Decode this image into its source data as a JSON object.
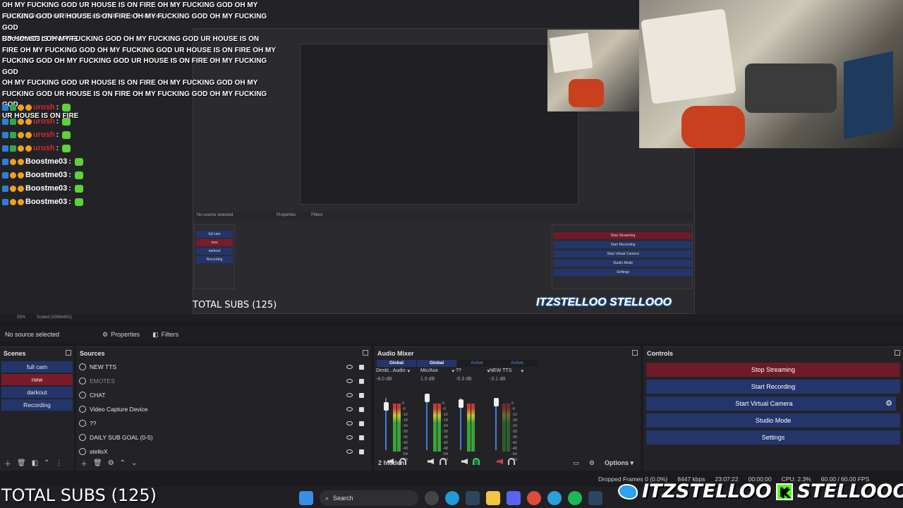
{
  "chat": {
    "top_lines": [
      "OH MY FUCKING GOD UR HOUSE IS ON FIRE OH MY FUCKING GOD OH MY",
      "FUCKING GOD UR HOUSE IS ON FIRE OH MY FUCKING GOD OH MY FUCKING GOD",
      "UR HOUSE IS ON FIRE"
    ],
    "second_lines": [
      "Boostme03 : OH MY FUCKING GOD OH MY FUCKING GOD UR HOUSE IS ON",
      "FIRE OH MY FUCKING GOD OH MY FUCKING GOD UR HOUSE IS ON FIRE OH MY",
      "FUCKING GOD OH MY FUCKING GOD UR HOUSE IS ON FIRE OH MY FUCKING GOD",
      "OH MY FUCKING GOD UR HOUSE IS ON FIRE OH MY FUCKING GOD OH MY",
      "FUCKING GOD UR HOUSE IS ON FIRE OH MY FUCKING GOD OH MY FUCKING GOD",
      "UR HOUSE IS ON FIRE"
    ],
    "rows": [
      {
        "user": "urosh",
        "sep": ":"
      },
      {
        "user": "urosh",
        "sep": ":"
      },
      {
        "user": "urosh",
        "sep": ":"
      },
      {
        "user": "urosh",
        "sep": ":"
      },
      {
        "user": "Boostme03",
        "sep": ":"
      },
      {
        "user": "Boostme03",
        "sep": ":"
      },
      {
        "user": "Boostme03",
        "sep": ":"
      },
      {
        "user": "Boostme03",
        "sep": ":"
      }
    ]
  },
  "menu": {
    "items": "File   Edit   View   Docks   Profile   Scene Collection   Tools   Help"
  },
  "nested_preview": {
    "subs": "TOTAL SUBS (125)",
    "handles": "ITZSTELLOO  STELLOOO",
    "no_source": "No source selected",
    "properties": "Properties",
    "filters": "Filters",
    "scenes": [
      "full cam",
      "new",
      "darkout",
      "Recording"
    ],
    "controls": [
      "Stop Streaming",
      "Start Recording",
      "Start Virtual Camera",
      "Studio Mode",
      "Settings"
    ]
  },
  "status_strip": {
    "zoom": "55%",
    "scaled": "Scaled (1069x601)"
  },
  "source_bar": {
    "no_source": "No source selected",
    "properties": "Properties",
    "filters": "Filters"
  },
  "scenes": {
    "title": "Scenes",
    "items": [
      {
        "label": "full cam",
        "active": false
      },
      {
        "label": "new",
        "active": true
      },
      {
        "label": "darkout",
        "active": false
      },
      {
        "label": "Recording",
        "active": false
      }
    ]
  },
  "sources": {
    "title": "Sources",
    "items": [
      {
        "label": "NEW TTS",
        "icon": "globe-icon"
      },
      {
        "label": "EMOTES",
        "icon": "globe-icon"
      },
      {
        "label": "CHAT",
        "icon": "globe-icon"
      },
      {
        "label": "Video Capture Device",
        "icon": "camera-icon"
      },
      {
        "label": "??",
        "icon": "globe-icon"
      },
      {
        "label": "DAILY SUB GOAL (0-5)",
        "icon": "text-icon"
      },
      {
        "label": "stelloX",
        "icon": "image-icon"
      }
    ]
  },
  "mixer": {
    "title": "Audio Mixer",
    "tabs": [
      "Global",
      "Global",
      "Active",
      "Active"
    ],
    "channels": [
      {
        "name": "Deskt...Audio",
        "db": "-8.0 dB"
      },
      {
        "name": "Mic/Aux",
        "db": "1.0 dB"
      },
      {
        "name": "??",
        "db": "-5.3 dB"
      },
      {
        "name": "NEW TTS",
        "db": "-3.1 dB"
      }
    ],
    "scale": [
      "0",
      "-6",
      "-12",
      "-18",
      "-24",
      "-30",
      "-36",
      "-42",
      "-48",
      "-54",
      "-60"
    ],
    "hidden": "2 hidden",
    "options": "Options"
  },
  "controls": {
    "title": "Controls",
    "buttons": [
      "Stop Streaming",
      "Start Recording",
      "Start Virtual Camera",
      "Studio Mode",
      "Settings"
    ]
  },
  "stats": {
    "dropped": "Dropped Frames 0 (0.0%)",
    "bitrate": "8447 kbps",
    "time1": "23:07:22",
    "time2": "00:00:00",
    "cpu": "CPU: 2.3%",
    "fps": "60.00 / 60.00 FPS"
  },
  "overlay": {
    "total_subs": "TOTAL SUBS (125)",
    "handle1": "ITZSTELLOO",
    "handle2": "STELLOOO"
  },
  "taskbar": {
    "search": "Search"
  },
  "colors": {
    "accent_blue": "#23356a",
    "stop_red": "#6e1a28",
    "active_tab": "#5a8cd8"
  }
}
